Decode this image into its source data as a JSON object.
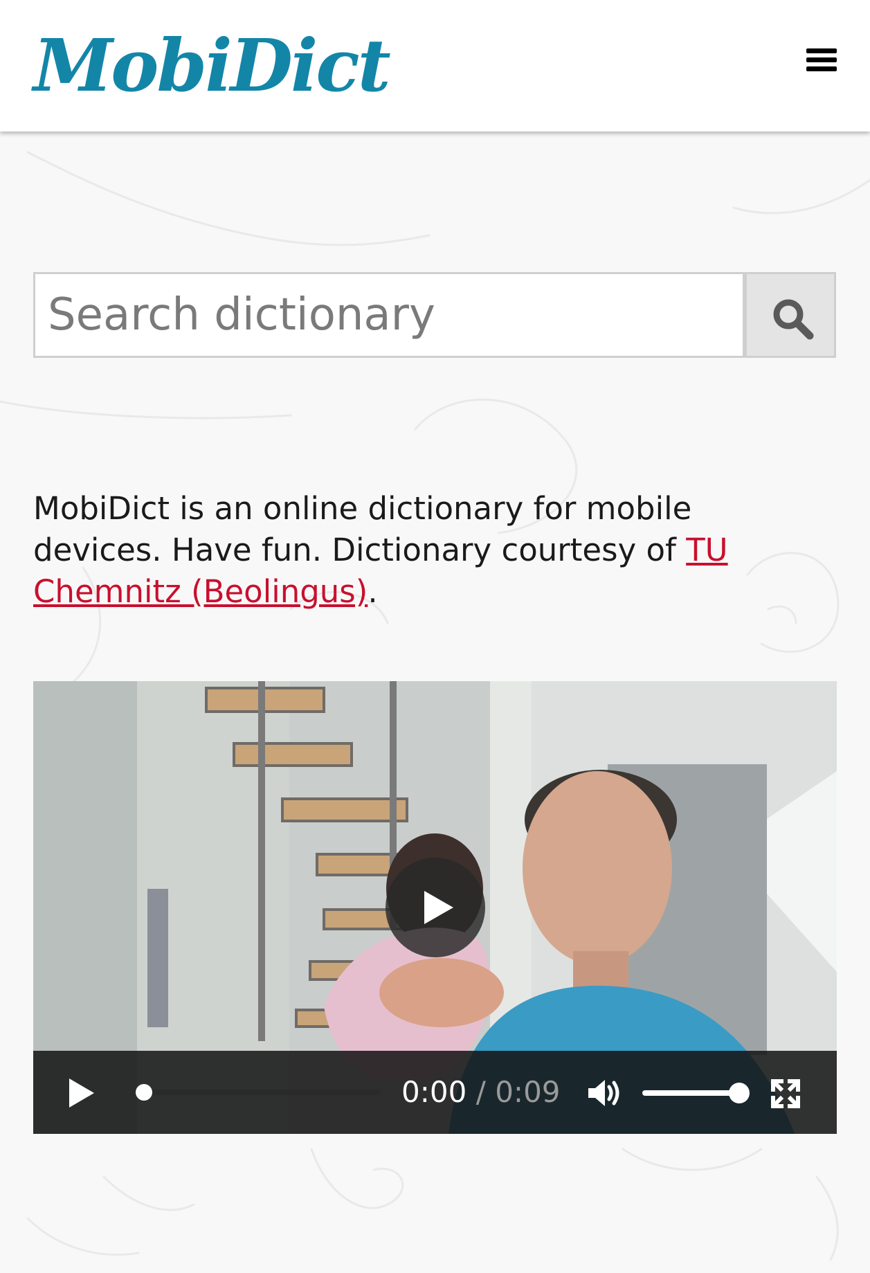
{
  "header": {
    "logo_text": "MobiDict",
    "menu_icon": "hamburger-menu-icon"
  },
  "search": {
    "placeholder": "Search dictionary",
    "value": "",
    "button_icon": "search-icon"
  },
  "intro": {
    "text_before_link": "MobiDict is an online dictionary for mobile devices. Have fun. Dictionary courtesy of ",
    "link_text": "TU Chemnitz (Beolingus)",
    "text_after_link": "."
  },
  "video": {
    "current_time": "0:00",
    "separator": "/",
    "duration": "0:09",
    "progress": 0,
    "volume": 1
  },
  "colors": {
    "brand": "#1386a8",
    "link": "#c8102e",
    "background": "#f8f8f8"
  }
}
